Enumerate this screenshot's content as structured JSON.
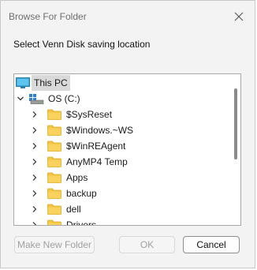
{
  "window": {
    "title": "Browse For Folder",
    "close_icon": "close-icon"
  },
  "prompt": "Select Venn Disk saving location",
  "tree": {
    "root": {
      "label": "This PC",
      "icon": "this-pc-icon",
      "selected": true
    },
    "drive": {
      "label": "OS (C:)",
      "icon": "drive-icon",
      "expanded": true
    },
    "folders": [
      {
        "label": "$SysReset"
      },
      {
        "label": "$Windows.~WS"
      },
      {
        "label": "$WinREAgent"
      },
      {
        "label": "AnyMP4 Temp"
      },
      {
        "label": "Apps"
      },
      {
        "label": "backup"
      },
      {
        "label": "dell"
      },
      {
        "label": "Drivers"
      }
    ]
  },
  "buttons": {
    "make_new_folder": "Make New Folder",
    "ok": "OK",
    "cancel": "Cancel"
  },
  "colors": {
    "folder": "#f4c542",
    "selection": "#d9d9d9"
  }
}
